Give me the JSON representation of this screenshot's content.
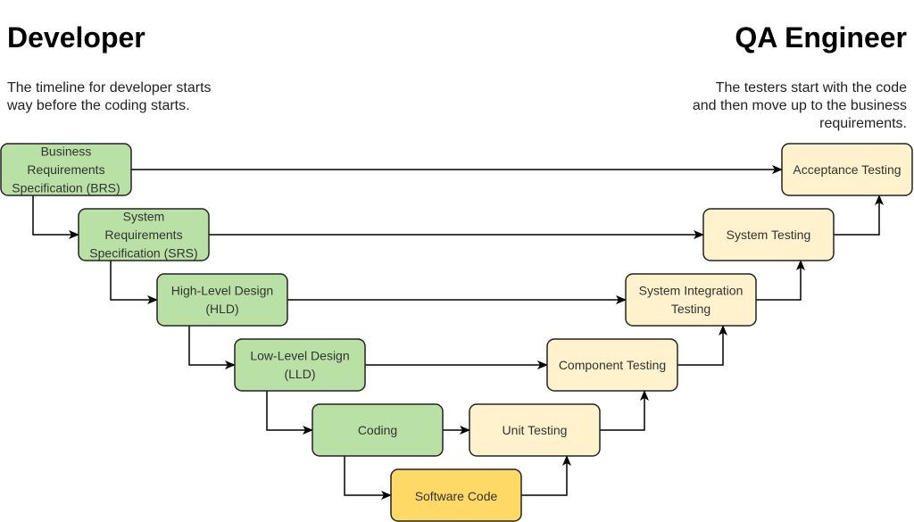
{
  "left": {
    "title": "Developer",
    "description": [
      "The timeline for developer starts",
      "way before the coding starts."
    ]
  },
  "right": {
    "title": "QA Engineer",
    "description": [
      "The testers start with the code",
      "and then move up to the business",
      "requirements."
    ]
  },
  "colors": {
    "developer": "#b9e0a5",
    "tester": "#fff2cc",
    "code": "#ffd966",
    "border": "#222222"
  },
  "nodes": [
    {
      "id": "brs",
      "lines": [
        "Business",
        "Requirements",
        "Specification (BRS)"
      ],
      "type": "developer"
    },
    {
      "id": "srs",
      "lines": [
        "System",
        "Requirements",
        "Specification (SRS)"
      ],
      "type": "developer"
    },
    {
      "id": "hld",
      "lines": [
        "High-Level Design",
        "(HLD)"
      ],
      "type": "developer"
    },
    {
      "id": "lld",
      "lines": [
        "Low-Level Design",
        "(LLD)"
      ],
      "type": "developer"
    },
    {
      "id": "coding",
      "lines": [
        "Coding"
      ],
      "type": "developer"
    },
    {
      "id": "code",
      "lines": [
        "Software Code"
      ],
      "type": "code"
    },
    {
      "id": "unit",
      "lines": [
        "Unit Testing"
      ],
      "type": "tester"
    },
    {
      "id": "component",
      "lines": [
        "Component Testing"
      ],
      "type": "tester"
    },
    {
      "id": "sit",
      "lines": [
        "System Integration",
        "Testing"
      ],
      "type": "tester"
    },
    {
      "id": "system",
      "lines": [
        "System Testing"
      ],
      "type": "tester"
    },
    {
      "id": "acceptance",
      "lines": [
        "Acceptance Testing"
      ],
      "type": "tester"
    }
  ],
  "edges": [
    [
      "brs",
      "srs"
    ],
    [
      "srs",
      "hld"
    ],
    [
      "hld",
      "lld"
    ],
    [
      "lld",
      "coding"
    ],
    [
      "coding",
      "code"
    ],
    [
      "brs",
      "acceptance"
    ],
    [
      "srs",
      "system"
    ],
    [
      "hld",
      "sit"
    ],
    [
      "lld",
      "component"
    ],
    [
      "coding",
      "unit"
    ],
    [
      "code",
      "unit"
    ],
    [
      "unit",
      "component"
    ],
    [
      "component",
      "sit"
    ],
    [
      "sit",
      "system"
    ],
    [
      "system",
      "acceptance"
    ]
  ]
}
